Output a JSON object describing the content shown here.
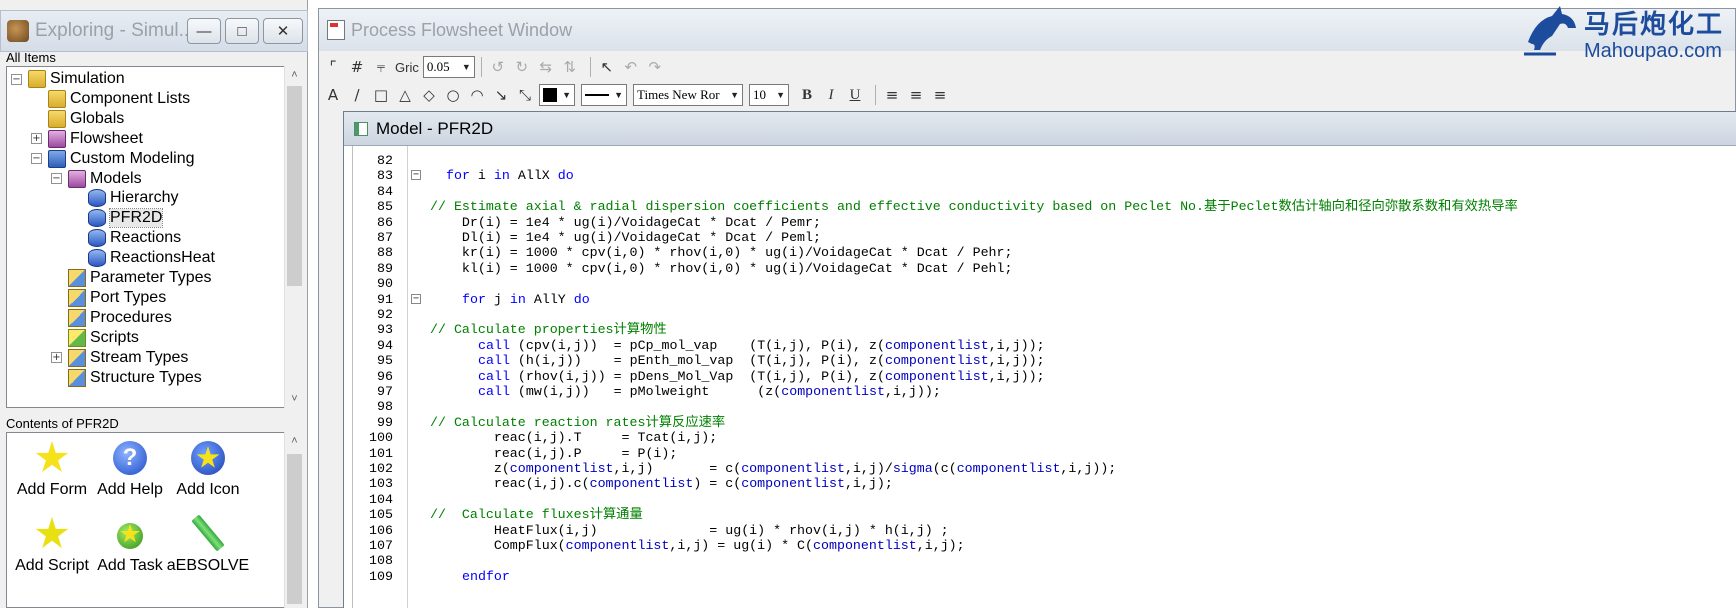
{
  "explorer": {
    "title": "Exploring - Simul...",
    "all_items_label": "All Items",
    "tree": [
      {
        "label": "Simulation",
        "icon": "folder-icon",
        "expander": "−"
      },
      {
        "label": "Component Lists",
        "icon": "folder-icon"
      },
      {
        "label": "Globals",
        "icon": "folder-icon"
      },
      {
        "label": "Flowsheet",
        "icon": "flowsheet-icon",
        "expander": "+"
      },
      {
        "label": "Custom Modeling",
        "icon": "custom-modeling-icon",
        "expander": "−"
      },
      {
        "label": "Models",
        "icon": "models-folder-icon",
        "expander": "−"
      },
      {
        "label": "Hierarchy",
        "icon": "model-icon"
      },
      {
        "label": "PFR2D",
        "icon": "model-icon",
        "selected": true
      },
      {
        "label": "Reactions",
        "icon": "model-icon"
      },
      {
        "label": "ReactionsHeat",
        "icon": "model-icon"
      },
      {
        "label": "Parameter Types",
        "icon": "type-icon"
      },
      {
        "label": "Port Types",
        "icon": "type-icon"
      },
      {
        "label": "Procedures",
        "icon": "type-icon"
      },
      {
        "label": "Scripts",
        "icon": "script-icon"
      },
      {
        "label": "Stream Types",
        "icon": "type-icon",
        "expander": "+"
      },
      {
        "label": "Structure Types",
        "icon": "type-icon"
      }
    ],
    "contents_label": "Contents of PFR2D",
    "tools": [
      {
        "label": "Add Form",
        "icon": "add-form-icon"
      },
      {
        "label": "Add Help",
        "icon": "add-help-icon"
      },
      {
        "label": "Add Icon",
        "icon": "add-icon-icon"
      },
      {
        "label": "Add Script",
        "icon": "add-script-icon"
      },
      {
        "label": "Add Task",
        "icon": "add-task-icon"
      },
      {
        "label": "aEBSOLVE",
        "icon": "aebsolve-icon"
      }
    ]
  },
  "flowsheet": {
    "title": "Process Flowsheet Window",
    "grid_label": "Gric",
    "grid_value": "0.05",
    "font_name": "Times New Ror",
    "font_size": "10"
  },
  "model_window": {
    "title": "Model - PFR2D"
  },
  "code": [
    {
      "n": "82",
      "t": ""
    },
    {
      "n": "83",
      "t": "for i in AllX do",
      "fold": true,
      "indent": 1
    },
    {
      "n": "84",
      "t": ""
    },
    {
      "n": "85",
      "t": "// Estimate axial & radial dispersion coefficients and effective conductivity based on Peclet No.基于Peclet数估计轴向和径向弥散系数和有效热导率",
      "comment": true
    },
    {
      "n": "86",
      "t": "    Dr(i) = 1e4 * ug(i)/VoidageCat * Dcat / Pemr;"
    },
    {
      "n": "87",
      "t": "    Dl(i) = 1e4 * ug(i)/VoidageCat * Dcat / Peml;"
    },
    {
      "n": "88",
      "t": "    kr(i) = 1000 * cpv(i,0) * rhov(i,0) * ug(i)/VoidageCat * Dcat / Pehr;"
    },
    {
      "n": "89",
      "t": "    kl(i) = 1000 * cpv(i,0) * rhov(i,0) * ug(i)/VoidageCat * Dcat / Pehl;"
    },
    {
      "n": "90",
      "t": ""
    },
    {
      "n": "91",
      "t": "for j in AllY do",
      "fold": true,
      "indent": 2
    },
    {
      "n": "92",
      "t": ""
    },
    {
      "n": "93",
      "t": "// Calculate properties计算物性",
      "comment": true
    },
    {
      "n": "94",
      "t": "call (cpv(i,j))  = pCp_mol_vap    (T(i,j), P(i), z(componentlist,i,j));",
      "call": true
    },
    {
      "n": "95",
      "t": "call (h(i,j))    = pEnth_mol_vap  (T(i,j), P(i), z(componentlist,i,j));",
      "call": true
    },
    {
      "n": "96",
      "t": "call (rhov(i,j)) = pDens_Mol_Vap  (T(i,j), P(i), z(componentlist,i,j));",
      "call": true
    },
    {
      "n": "97",
      "t": "call (mw(i,j))   = pMolweight      (z(componentlist,i,j));",
      "call": true
    },
    {
      "n": "98",
      "t": ""
    },
    {
      "n": "99",
      "t": "// Calculate reaction rates计算反应速率",
      "comment": true
    },
    {
      "n": "100",
      "t": "        reac(i,j).T     = Tcat(i,j);"
    },
    {
      "n": "101",
      "t": "        reac(i,j).P     = P(i);"
    },
    {
      "n": "102",
      "t": "        z(componentlist,i,j)       = c(componentlist,i,j)/sigma(c(componentlist,i,j));"
    },
    {
      "n": "103",
      "t": "        reac(i,j).c(componentlist) = c(componentlist,i,j);"
    },
    {
      "n": "104",
      "t": ""
    },
    {
      "n": "105",
      "t": "//  Calculate fluxes计算通量",
      "comment": true
    },
    {
      "n": "106",
      "t": "        HeatFlux(i,j)              = ug(i) * rhov(i,j) * h(i,j) ;"
    },
    {
      "n": "107",
      "t": "        CompFlux(componentlist,i,j) = ug(i) * C(componentlist,i,j);"
    },
    {
      "n": "108",
      "t": ""
    },
    {
      "n": "109",
      "t": "endfor",
      "indent": 2
    }
  ],
  "logo": {
    "cn": "马后炮化工",
    "en": "Mahoupao.com"
  },
  "colors": {
    "keyword": "#0000ff",
    "comment": "#008000",
    "identifier": "#0000c0"
  }
}
